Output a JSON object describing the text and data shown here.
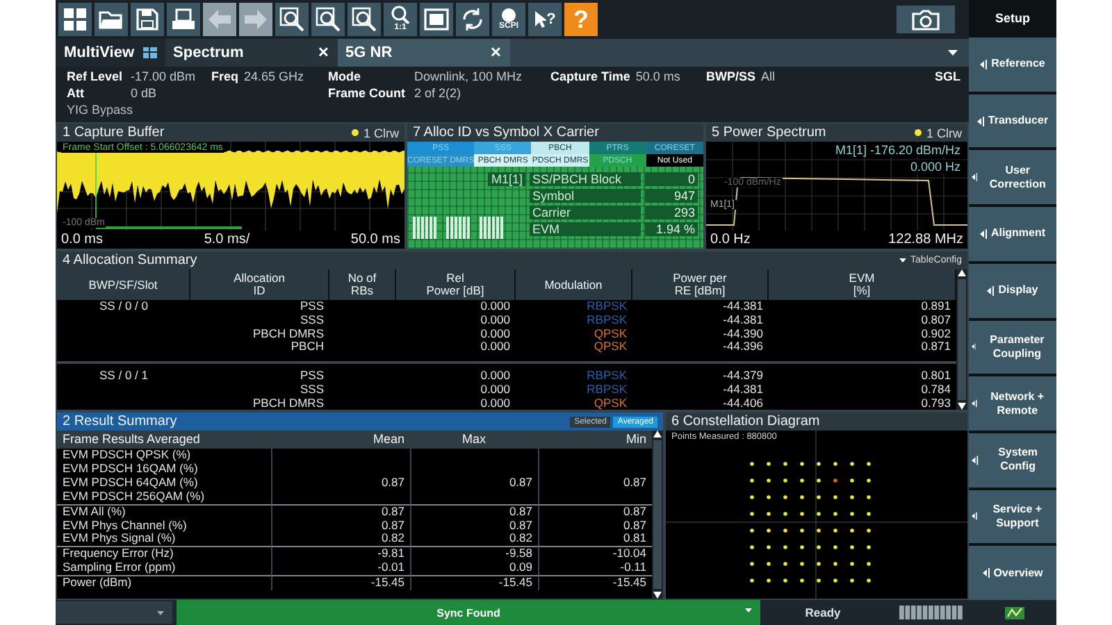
{
  "toolbar": {
    "buttons": [
      {
        "kind": "windows",
        "disabled": false
      },
      {
        "kind": "open",
        "disabled": false
      },
      {
        "kind": "save",
        "disabled": false
      },
      {
        "kind": "print",
        "disabled": false
      },
      {
        "kind": "undo",
        "disabled": true
      },
      {
        "kind": "redo",
        "disabled": true
      },
      {
        "kind": "zoom-multi",
        "disabled": false
      },
      {
        "kind": "zoom",
        "disabled": false
      },
      {
        "kind": "zoom-out",
        "disabled": false
      },
      {
        "kind": "zoom-fit",
        "disabled": false,
        "label": "1:1"
      },
      {
        "kind": "fullscreen",
        "disabled": false
      },
      {
        "kind": "refresh",
        "disabled": false
      },
      {
        "kind": "scpi",
        "disabled": false,
        "label": "SCPI"
      },
      {
        "kind": "pointer-help",
        "disabled": false,
        "label": "?"
      },
      {
        "kind": "help",
        "disabled": false,
        "label": "?"
      }
    ],
    "camera": {
      "kind": "camera"
    }
  },
  "softkeys": {
    "title": "Setup",
    "items": [
      {
        "label": "Reference"
      },
      {
        "label": "Transducer"
      },
      {
        "label": "User Correction"
      },
      {
        "label": "Alignment"
      },
      {
        "label": "Display"
      },
      {
        "label": "Parameter Coupling"
      },
      {
        "label": "Network + Remote"
      },
      {
        "label": "System Config"
      },
      {
        "label": "Service + Support"
      },
      {
        "label": "Overview"
      }
    ]
  },
  "tabs": [
    {
      "label": "MultiView",
      "kind": "overview",
      "selected": false
    },
    {
      "label": "Spectrum",
      "kind": "channel",
      "selected": false,
      "close": "✕"
    },
    {
      "label": "5G NR",
      "kind": "channel",
      "selected": true,
      "close": "✕"
    }
  ],
  "info": {
    "columns": [
      [
        {
          "kind": "setting",
          "label": "Ref Level",
          "value": "-17.00 dBm"
        },
        {
          "kind": "setting",
          "label": "Att",
          "value": "0 dB"
        },
        {
          "kind": "note",
          "label": "YIG Bypass"
        }
      ],
      [
        {
          "kind": "setting",
          "label": "Freq",
          "value": "24.65 GHz"
        }
      ],
      [
        {
          "kind": "setting",
          "label": "Mode",
          "value": "Downlink, 100 MHz"
        },
        {
          "kind": "setting",
          "label": "Frame Count",
          "value": "2 of 2(2)"
        }
      ],
      [
        {
          "kind": "setting",
          "label": "Capture Time",
          "value": "50.0 ms"
        }
      ],
      [
        {
          "kind": "setting",
          "label": "BWP/SS",
          "value": "All"
        }
      ]
    ],
    "sweep_mode": "SGL"
  },
  "capture_buffer": {
    "title": "1 Capture Buffer",
    "trace": "1 Clrw",
    "offset": "Frame Start Offset : 5.066023642 ms",
    "ref_label": "-100 dBm",
    "x_start": "0.0 ms",
    "x_div": "5.0 ms/",
    "x_end": "50.0 ms"
  },
  "alloc_plot": {
    "title": "7 Alloc ID vs Symbol X Carrier",
    "legend": [
      {
        "label": "PSS",
        "color": "#1c8fd4"
      },
      {
        "label": "SSS",
        "color": "#38a6dc"
      },
      {
        "label": "PBCH",
        "color": "#bfe9ef"
      },
      {
        "label": "PTRS",
        "color": "#157a73"
      },
      {
        "label": "CORESET",
        "color": "#1b6f86"
      },
      {
        "label": "CORESET DMRS",
        "color": "#2a8fc4"
      },
      {
        "label": "PBCH DMRS",
        "color": "#d4f1f4"
      },
      {
        "label": "PDSCH DMRS",
        "color": "#cdeef2"
      },
      {
        "label": "PDSCH",
        "color": "#23a349"
      },
      {
        "label": "Not Used",
        "color": "#000000"
      }
    ],
    "marker": "M1[1]",
    "readout": [
      {
        "label": "SS/PBCH Block",
        "value": "0"
      },
      {
        "label": "Symbol",
        "value": "947"
      },
      {
        "label": "Carrier",
        "value": "293"
      },
      {
        "label": "EVM",
        "value": "1.94 %"
      }
    ]
  },
  "power_spectrum": {
    "title": "5 Power Spectrum",
    "trace": "1 Clrw",
    "marker_readout": "M1[1] -176.20 dBm/Hz",
    "marker_freq": "0.000 Hz",
    "ref_label": "-100 dBm/Hz",
    "marker": "M1[1]",
    "x_start": "0.0 Hz",
    "x_end": "122.88 MHz"
  },
  "allocation_summary": {
    "title": "4 Allocation Summary",
    "config": "TableConfig",
    "columns": [
      "BWP/SF/Slot",
      "Allocation\nID",
      "No of\nRBs",
      "Rel\nPower [dB]",
      "Modulation",
      "Power per\nRE [dBm]",
      "EVM\n[%]"
    ],
    "groups": [
      {
        "slot": "SS / 0 / 0",
        "rows": [
          {
            "allocation": "PSS",
            "rel_power": "0.000",
            "modulation": "RBPSK",
            "color": "#2c5fae",
            "power": "-44.381",
            "evm": "0.891"
          },
          {
            "allocation": "SSS",
            "rel_power": "0.000",
            "modulation": "RBPSK",
            "color": "#2c5fae",
            "power": "-44.381",
            "evm": "0.807"
          },
          {
            "allocation": "PBCH DMRS",
            "rel_power": "0.000",
            "modulation": "QPSK",
            "color": "#d9742a",
            "power": "-44.390",
            "evm": "0.902"
          },
          {
            "allocation": "PBCH",
            "rel_power": "0.000",
            "modulation": "QPSK",
            "color": "#d9742a",
            "power": "-44.396",
            "evm": "0.871"
          }
        ]
      },
      {
        "slot": "SS / 0 / 1",
        "rows": [
          {
            "allocation": "PSS",
            "rel_power": "0.000",
            "modulation": "RBPSK",
            "color": "#2c5fae",
            "power": "-44.379",
            "evm": "0.801"
          },
          {
            "allocation": "SSS",
            "rel_power": "0.000",
            "modulation": "RBPSK",
            "color": "#2c5fae",
            "power": "-44.381",
            "evm": "0.784"
          },
          {
            "allocation": "PBCH DMRS",
            "rel_power": "0.000",
            "modulation": "QPSK",
            "color": "#d9742a",
            "power": "-44.406",
            "evm": "0.793"
          }
        ]
      }
    ]
  },
  "result_summary": {
    "title": "2 Result Summary",
    "modes": [
      {
        "label": "Selected",
        "selected": false
      },
      {
        "label": "Averaged",
        "selected": true
      }
    ],
    "columns": [
      "Frame Results Averaged",
      "Mean",
      "Max",
      "Min"
    ],
    "groups": [
      {
        "rows": [
          {
            "label": "EVM PDSCH QPSK (%)"
          },
          {
            "label": "EVM PDSCH 16QAM (%)"
          },
          {
            "label": "EVM PDSCH 64QAM (%)",
            "mean": "0.87",
            "max": "0.87",
            "min": "0.87"
          },
          {
            "label": "EVM PDSCH 256QAM (%)"
          }
        ]
      },
      {
        "rows": [
          {
            "label": "EVM All (%)",
            "mean": "0.87",
            "max": "0.87",
            "min": "0.87"
          },
          {
            "label": "EVM Phys Channel (%)",
            "mean": "0.87",
            "max": "0.87",
            "min": "0.87"
          },
          {
            "label": "EVM Phys Signal (%)",
            "mean": "0.82",
            "max": "0.82",
            "min": "0.81"
          }
        ]
      },
      {
        "rows": [
          {
            "label": "Frequency Error (Hz)",
            "mean": "-9.81",
            "max": "-9.58",
            "min": "-10.04"
          },
          {
            "label": "Sampling Error (ppm)",
            "mean": "-0.01",
            "max": "0.09",
            "min": "-0.11"
          }
        ]
      },
      {
        "rows": [
          {
            "label": "Power (dBm)",
            "mean": "-15.45",
            "max": "-15.45",
            "min": "-15.45"
          }
        ]
      }
    ]
  },
  "constellation": {
    "title": "6 Constellation Diagram",
    "points": "Points Measured : 880800"
  },
  "status_bar": {
    "message": "Sync Found",
    "state": "Ready"
  }
}
